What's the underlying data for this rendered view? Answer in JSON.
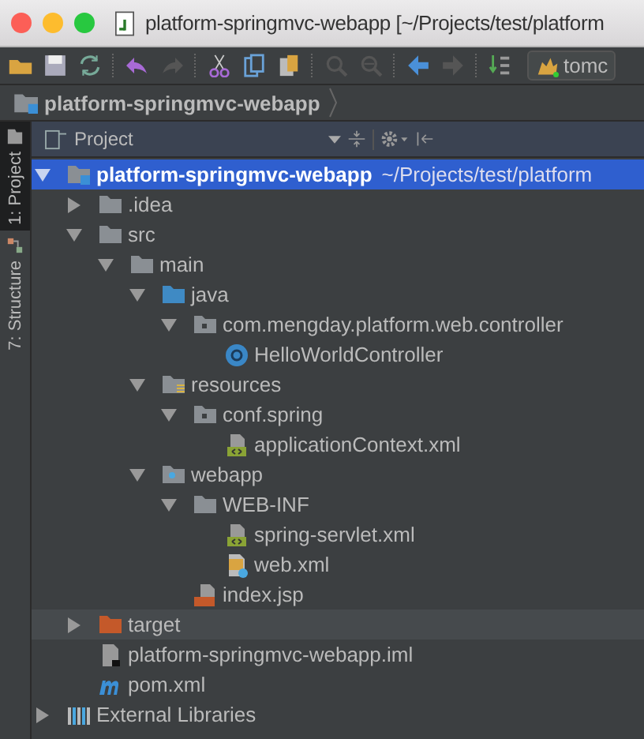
{
  "window": {
    "title": "platform-springmvc-webapp [~/Projects/test/platform"
  },
  "toolbar": {
    "run_config": "tomc"
  },
  "breadcrumb": {
    "label": "platform-springmvc-webapp"
  },
  "side_tabs": [
    {
      "label": "1: Project",
      "selected": true
    },
    {
      "label": "7: Structure",
      "selected": false
    }
  ],
  "panel": {
    "title": "Project"
  },
  "tree": [
    {
      "kind": "module",
      "label": "platform-springmvc-webapp",
      "path": "~/Projects/test/platform",
      "expanded": true,
      "selected": true,
      "hovered": false,
      "children": [
        {
          "kind": "folder",
          "label": ".idea",
          "expanded": false,
          "selected": false,
          "hovered": false
        },
        {
          "kind": "folder",
          "label": "src",
          "expanded": true,
          "selected": false,
          "hovered": false,
          "children": [
            {
              "kind": "folder",
              "label": "main",
              "expanded": true,
              "selected": false,
              "hovered": false,
              "children": [
                {
                  "kind": "source",
                  "label": "java",
                  "expanded": true,
                  "selected": false,
                  "hovered": false,
                  "children": [
                    {
                      "kind": "package",
                      "label": "com.mengday.platform.web.controller",
                      "expanded": true,
                      "selected": false,
                      "hovered": false,
                      "children": [
                        {
                          "kind": "class",
                          "label": "HelloWorldController",
                          "selected": false,
                          "hovered": false
                        }
                      ]
                    }
                  ]
                },
                {
                  "kind": "resources",
                  "label": "resources",
                  "expanded": true,
                  "selected": false,
                  "hovered": false,
                  "children": [
                    {
                      "kind": "package",
                      "label": "conf.spring",
                      "expanded": true,
                      "selected": false,
                      "hovered": false,
                      "children": [
                        {
                          "kind": "xml",
                          "label": "applicationContext.xml",
                          "selected": false,
                          "hovered": false
                        }
                      ]
                    }
                  ]
                },
                {
                  "kind": "web",
                  "label": "webapp",
                  "expanded": true,
                  "selected": false,
                  "hovered": false,
                  "children": [
                    {
                      "kind": "folder",
                      "label": "WEB-INF",
                      "expanded": true,
                      "selected": false,
                      "hovered": false,
                      "children": [
                        {
                          "kind": "xml",
                          "label": "spring-servlet.xml",
                          "selected": false,
                          "hovered": false
                        },
                        {
                          "kind": "webxml",
                          "label": "web.xml",
                          "selected": false,
                          "hovered": false
                        }
                      ]
                    },
                    {
                      "kind": "jsp",
                      "label": "index.jsp",
                      "selected": false,
                      "hovered": false
                    }
                  ]
                }
              ]
            }
          ]
        },
        {
          "kind": "excluded",
          "label": "target",
          "expanded": false,
          "selected": false,
          "hovered": true
        },
        {
          "kind": "iml",
          "label": "platform-springmvc-webapp.iml",
          "selected": false,
          "hovered": false
        },
        {
          "kind": "maven",
          "label": "pom.xml",
          "selected": false,
          "hovered": false
        }
      ]
    },
    {
      "kind": "libraries",
      "label": "External Libraries",
      "expanded": false,
      "selected": false,
      "hovered": false
    }
  ]
}
